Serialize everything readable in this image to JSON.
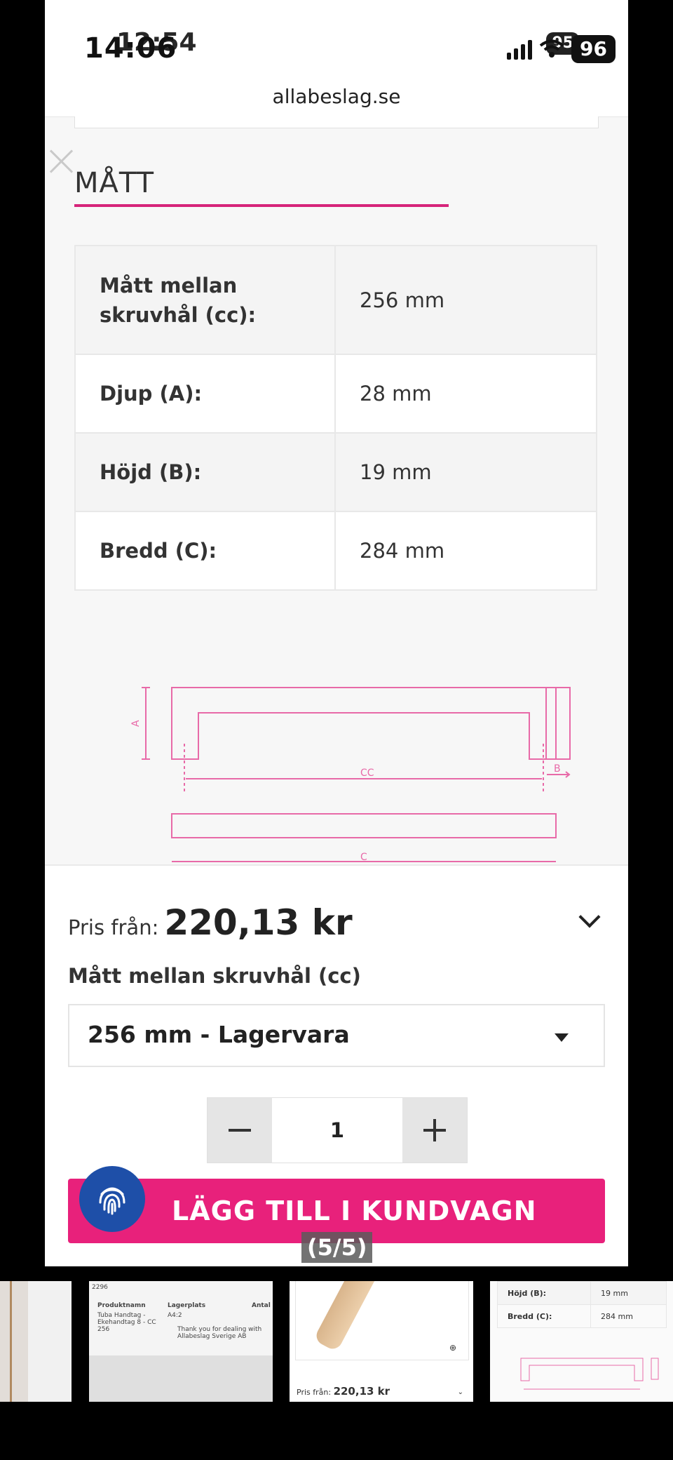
{
  "status_bar": {
    "time": "14:06",
    "time_ghost": "12:54",
    "battery": "96",
    "battery_ghost": "95"
  },
  "browser": {
    "url": "allabeslag.se"
  },
  "section": {
    "title": "MÅTT"
  },
  "dimensions": [
    {
      "label": "Mått mellan skruvhål (cc):",
      "value": "256 mm"
    },
    {
      "label": "Djup (A):",
      "value": "28 mm"
    },
    {
      "label": "Höjd (B):",
      "value": "19 mm"
    },
    {
      "label": "Bredd (C):",
      "value": "284 mm"
    }
  ],
  "diagram": {
    "label_a": "A",
    "label_b": "B",
    "label_cc": "CC",
    "label_c": "C"
  },
  "purchase": {
    "price_label": "Pris från:",
    "price_value": "220,13 kr",
    "select_label": "Mått mellan skruvhål (cc)",
    "select_value": "256 mm - Lagervara",
    "quantity": "1",
    "add_to_cart": "LÄGG TILL I KUNDVAGN"
  },
  "gallery": {
    "counter": "(5/5)"
  },
  "thumbnails": {
    "t2": {
      "col1": "Produktnamn",
      "col2": "Lagerplats",
      "col3": "Antal",
      "row_name": "Tuba Handtag - Ekehandtag 8 - CC 256",
      "row_loc": "A4:2",
      "note": "Thank you for dealing with Allabeslag Sverige AB",
      "header": "2296"
    },
    "t3": {
      "price_label": "Pris från:",
      "price_value": "220,13 kr"
    },
    "t4": {
      "row1_label": "Höjd (B):",
      "row1_value": "19 mm",
      "row2_label": "Bredd (C):",
      "row2_value": "284 mm"
    }
  },
  "colors": {
    "accent": "#e8217b",
    "underline": "#d6247a",
    "diagram_line": "#e86aa8",
    "fingerprint_bg": "#1e4fa8"
  }
}
